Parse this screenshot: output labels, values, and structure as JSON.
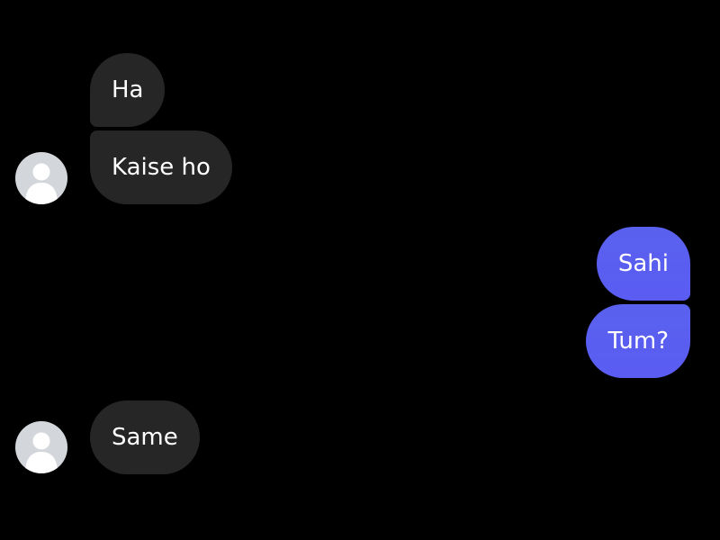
{
  "colors": {
    "background": "#000000",
    "incoming_bubble": "#262626",
    "outgoing_bubble_top": "#5a61ee",
    "outgoing_bubble_bottom": "#5a5cf2",
    "text": "#ffffff",
    "avatar_placeholder": "#d3d6db"
  },
  "messages": [
    {
      "direction": "incoming",
      "text": "Ha"
    },
    {
      "direction": "incoming",
      "text": "Kaise ho"
    },
    {
      "direction": "outgoing",
      "text": "Sahi"
    },
    {
      "direction": "outgoing",
      "text": "Tum?"
    },
    {
      "direction": "incoming",
      "text": "Same"
    }
  ],
  "avatar_icon": "default-user-silhouette-icon"
}
